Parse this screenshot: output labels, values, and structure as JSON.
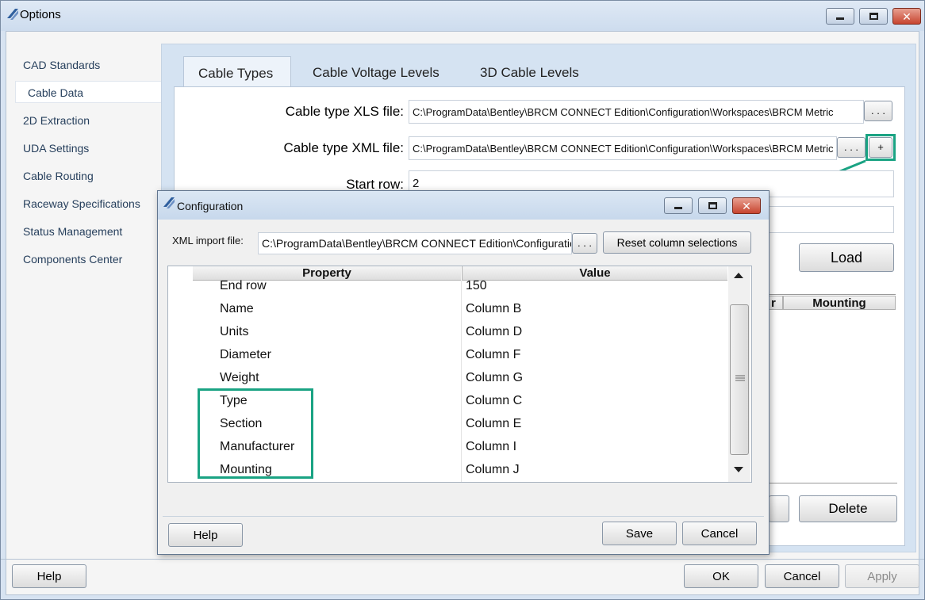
{
  "window": {
    "title": "Options",
    "buttons": {
      "minimize": "minimize",
      "maximize": "maximize",
      "close": "close"
    }
  },
  "sidebar": {
    "items": [
      {
        "label": "CAD Standards"
      },
      {
        "label": "Cable Data"
      },
      {
        "label": "2D Extraction"
      },
      {
        "label": "UDA Settings"
      },
      {
        "label": "Cable Routing"
      },
      {
        "label": "Raceway Specifications"
      },
      {
        "label": "Status Management"
      },
      {
        "label": "Components Center"
      }
    ],
    "selected": "Cable Data"
  },
  "tabs": [
    {
      "label": "Cable Types"
    },
    {
      "label": "Cable Voltage Levels"
    },
    {
      "label": "3D Cable Levels"
    }
  ],
  "cable_types": {
    "xls_label": "Cable type XLS file:",
    "xls_value": "C:\\ProgramData\\Bentley\\BRCM CONNECT Edition\\Configuration\\Workspaces\\BRCM Metric",
    "xml_label": "Cable type XML file:",
    "xml_value": "C:\\ProgramData\\Bentley\\BRCM CONNECT Edition\\Configuration\\Workspaces\\BRCM Metric",
    "start_row_label": "Start row:",
    "start_row_value": "2",
    "browse_label": ". . .",
    "plus_label": "+",
    "load_label": "Load",
    "table_header_partial": "r",
    "table_header_mounting": "Mounting",
    "delete_label": "Delete"
  },
  "footer": {
    "help": "Help",
    "ok": "OK",
    "cancel": "Cancel",
    "apply": "Apply"
  },
  "dialog": {
    "title": "Configuration",
    "xml_import_label": "XML import file:",
    "xml_import_value": "C:\\ProgramData\\Bentley\\BRCM CONNECT Edition\\Configuration",
    "browse_label": ". . .",
    "reset_label": "Reset column selections",
    "grid": {
      "headers": {
        "property": "Property",
        "value": "Value"
      },
      "rows": [
        {
          "property": "End row",
          "value": "150"
        },
        {
          "property": "Name",
          "value": "Column B"
        },
        {
          "property": "Units",
          "value": "Column D"
        },
        {
          "property": "Diameter",
          "value": "Column F"
        },
        {
          "property": "Weight",
          "value": "Column G"
        },
        {
          "property": "Type",
          "value": "Column C"
        },
        {
          "property": "Section",
          "value": "Column E"
        },
        {
          "property": "Manufacturer",
          "value": "Column I"
        },
        {
          "property": "Mounting",
          "value": "Column J"
        }
      ]
    },
    "help": "Help",
    "save": "Save",
    "cancel": "Cancel"
  },
  "colors": {
    "highlight": "#1aa383",
    "close_button": "#c7442f"
  }
}
